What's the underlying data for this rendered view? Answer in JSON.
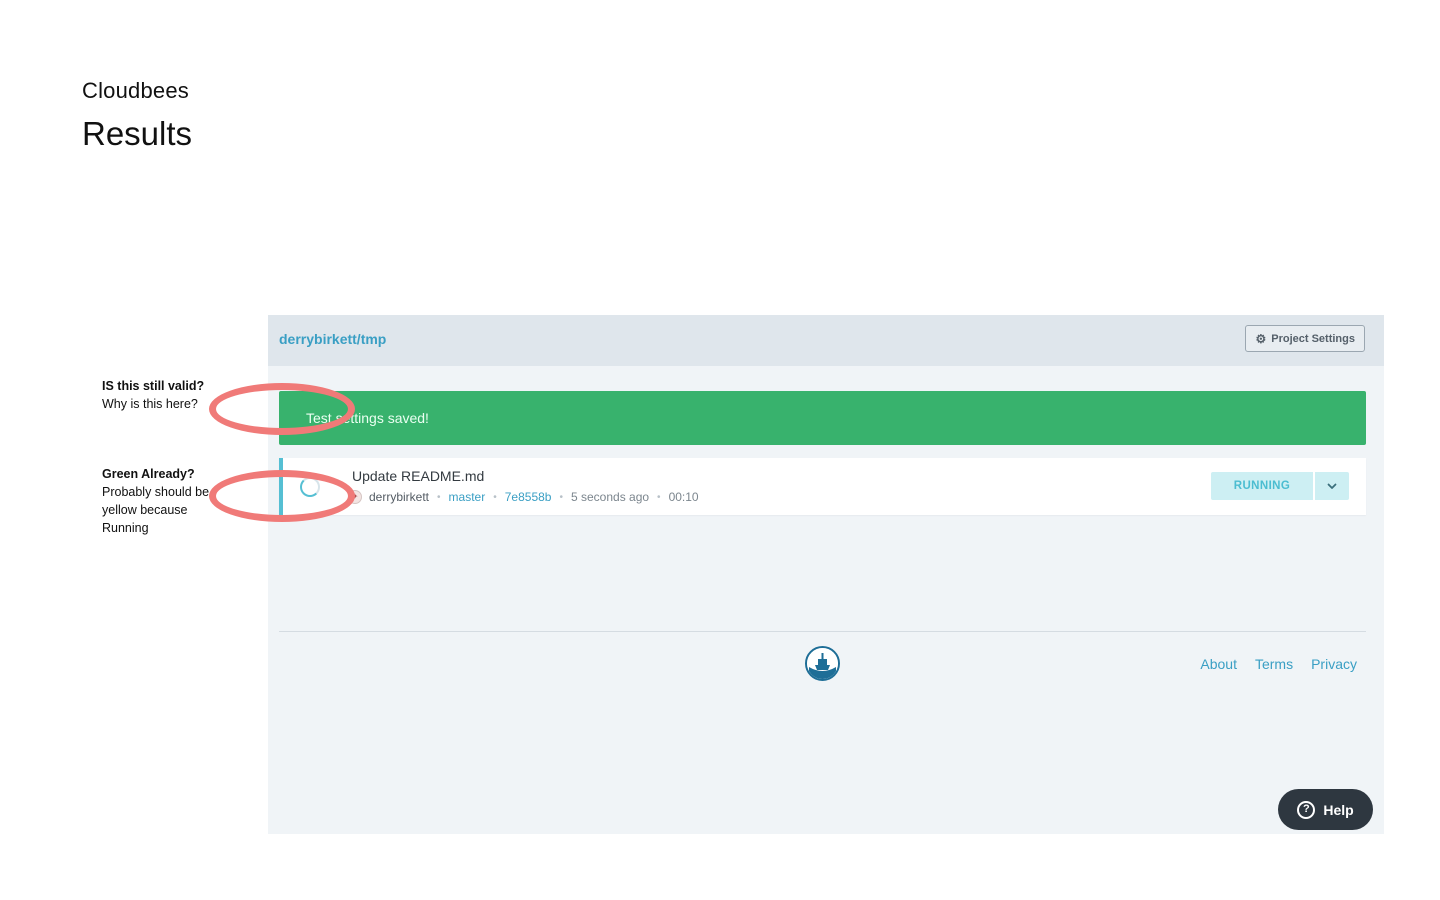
{
  "doc": {
    "subtitle": "Cloudbees",
    "title": "Results"
  },
  "notes": [
    {
      "question": "IS this still valid?",
      "body": "Why is this here?"
    },
    {
      "question": "Green Already?",
      "body": "Probably should be yellow because Running"
    }
  ],
  "app": {
    "repo": "derrybirkett/tmp",
    "settings_label": "Project Settings",
    "flash_message": "Test settings saved!",
    "build": {
      "commit_message": "Update README.md",
      "author": "derrybirkett",
      "branch": "master",
      "commit": "7e8558b",
      "time_ago": "5 seconds ago",
      "duration": "00:10",
      "status": "RUNNING"
    },
    "footer_links": {
      "about": "About",
      "terms": "Terms",
      "privacy": "Privacy"
    },
    "help_label": "Help"
  },
  "colors": {
    "accent": "#3a9fc4",
    "success": "#38b26d",
    "running": "#55bfd3",
    "annotation": "#f07a78",
    "help_bg": "#2e3740"
  },
  "icons": {
    "settings": "gear-icon",
    "status_toggle": "chevron-down-icon",
    "help": "question-circle-icon",
    "build_state": "spinner-icon",
    "logo": "ship-logo-icon"
  }
}
